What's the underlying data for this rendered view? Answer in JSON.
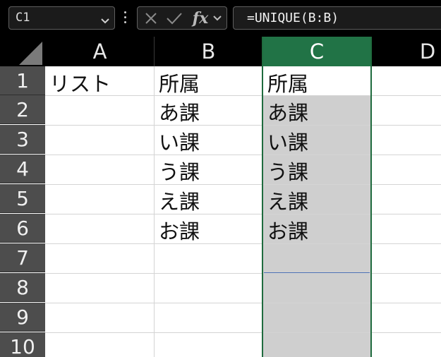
{
  "formula_bar": {
    "name_box": "C1",
    "formula": "=UNIQUE(B:B)",
    "fx_label": "fx"
  },
  "sheet": {
    "columns": [
      "A",
      "B",
      "C",
      "D"
    ],
    "selected_column": "C",
    "rows": [
      "1",
      "2",
      "3",
      "4",
      "5",
      "6",
      "7",
      "8",
      "9",
      "10"
    ],
    "cells": {
      "A1": "リスト",
      "B1": "所属",
      "B2": "あ課",
      "B3": "い課",
      "B4": "う課",
      "B5": "え課",
      "B6": "お課",
      "C1": "所属",
      "C2": "あ課",
      "C3": "い課",
      "C4": "う課",
      "C5": "え課",
      "C6": "お課"
    }
  },
  "colors": {
    "selection_header": "#217346",
    "selection_border": "#1f6b3e",
    "selection_fill": "#cfcfcf"
  }
}
